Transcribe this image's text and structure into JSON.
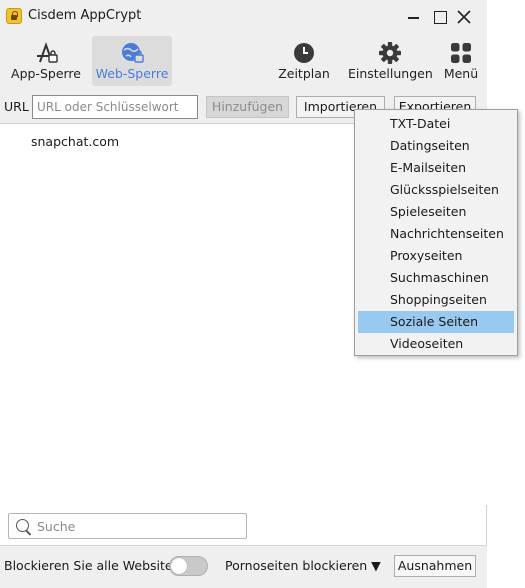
{
  "window": {
    "title": "Cisdem AppCrypt"
  },
  "toolbar": {
    "app_block": "App-Sperre",
    "web_block": "Web-Sperre",
    "schedule": "Zeitplan",
    "settings": "Einstellungen",
    "menu": "Menü",
    "active_tab": "Web-Sperre",
    "active_color": "#4a7dd8"
  },
  "url_bar": {
    "label": "URL",
    "placeholder": "URL oder Schlüsselwort",
    "value": "",
    "add_label": "Hinzufügen",
    "import_label": "Importieren",
    "export_label": "Exportieren"
  },
  "blocked_sites": [
    {
      "url": "snapchat.com"
    }
  ],
  "search": {
    "placeholder": "Suche"
  },
  "bottom_bar": {
    "block_all_label": "Blockieren Sie alle Websites",
    "block_all_enabled": false,
    "porn_label": "Pornoseiten blockieren ▼",
    "exceptions_label": "Ausnahmen"
  },
  "import_menu": {
    "items": [
      "TXT-Datei",
      "Datingseiten",
      "E-Mailseiten",
      "Glücksspielseiten",
      "Spieleseiten",
      "Nachrichtenseiten",
      "Proxyseiten",
      "Suchmaschinen",
      "Shoppingseiten",
      "Soziale Seiten",
      "Videoseiten"
    ],
    "selected": "Soziale Seiten",
    "highlight_color": "#99c9ef"
  }
}
